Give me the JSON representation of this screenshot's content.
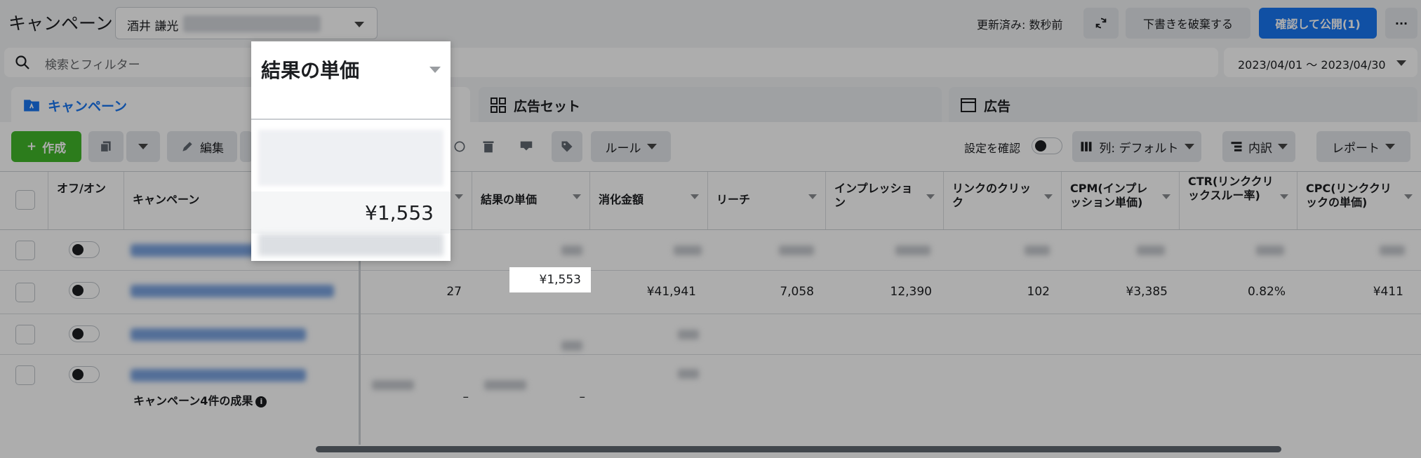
{
  "header": {
    "app_title": "キャンペーン",
    "account_name": "酒井 謙光",
    "updated_status": "更新済み: 数秒前",
    "discard_label": "下書きを破棄する",
    "publish_label": "確認して公開(1)",
    "more_label": "···"
  },
  "search": {
    "placeholder": "検索とフィルター",
    "date_range": "2023/04/01 ～ 2023/04/30"
  },
  "tabs": [
    {
      "label": "キャンペーン"
    },
    {
      "label": "広告セット"
    },
    {
      "label": "広告"
    }
  ],
  "toolbar": {
    "create_label": "作成",
    "edit_label": "編集",
    "rules_label": "ルール",
    "review_setting_label": "設定を確認",
    "columns_label": "列: デフォルト",
    "breakdown_label": "内訳",
    "report_label": "レポート"
  },
  "table": {
    "columns": [
      "オフ/オン",
      "キャンペーン",
      "結果の単価",
      "消化金額",
      "リーチ",
      "インプレッション",
      "リンクのクリック",
      "CPM(インプレッション単価)",
      "CTR(リンククリックスルー率)",
      "CPC(リンククリックの単価)"
    ],
    "highlight_row": {
      "results": "27",
      "cost_per_result": "¥1,553",
      "amount_spent": "¥41,941",
      "reach": "7,058",
      "impressions": "12,390",
      "link_clicks": "102",
      "cpm": "¥3,385",
      "ctr": "0.82%",
      "cpc": "¥411"
    },
    "summary_label": "キャンペーン4件の成果",
    "summary_results": "–",
    "summary_cost": "–"
  },
  "popup": {
    "title": "結果の単価",
    "value": "¥1,553"
  },
  "colors": {
    "accent": "#1877f2",
    "create": "#42b72a",
    "dim_overlay": "rgba(0,0,0,0.32)"
  }
}
